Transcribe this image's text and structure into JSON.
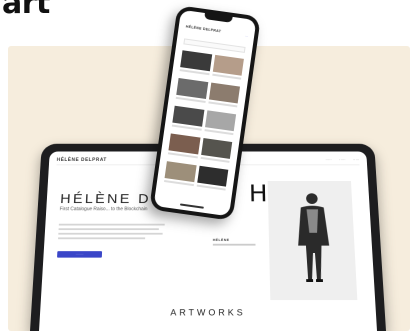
{
  "header": {
    "word": "art"
  },
  "tablet": {
    "brand": "HÉLÈNE DELPRAT",
    "nav_links": [
      "·····",
      "·····",
      "·····"
    ],
    "hero_title": "HÉLÈNE D",
    "hero_subtitle": "First Catalogue Raiso... to the Blockchain",
    "cta_label": "········",
    "caption_title": "HÉLÈNE",
    "h_letter": "H",
    "artworks_heading": "ARTWORKS"
  },
  "phone": {
    "brand": "HÉLÈNE DELPRAT",
    "menu_label": "···",
    "thumbnail_colors": [
      "#3a3a3a",
      "#b59d8a",
      "#6b6b6b",
      "#8c7c6e",
      "#4a4a4a",
      "#a7a7a7",
      "#7b5e4f",
      "#55544e",
      "#9d8f7a",
      "#2d2d2d"
    ]
  },
  "colors": {
    "panel": "#f6eddd",
    "device_frame": "#1d1d1f",
    "accent": "#3a46c8"
  }
}
